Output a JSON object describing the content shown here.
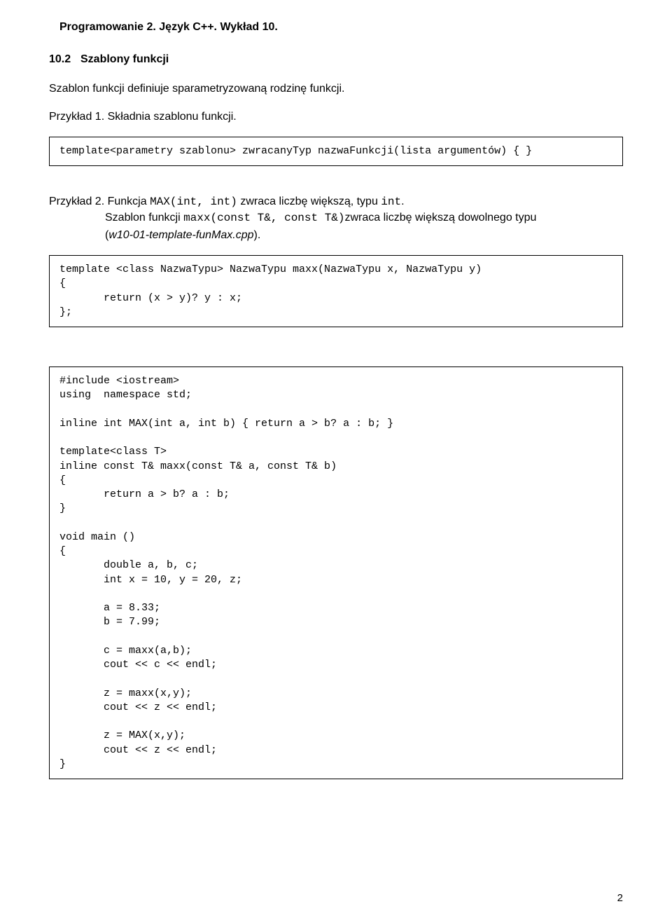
{
  "header": {
    "doc_title": "Programowanie 2. Język C++. Wykład 10."
  },
  "section": {
    "number": "10.2",
    "title": "Szablony funkcji"
  },
  "intro": {
    "sentence": "Szablon funkcji definiuje sparametryzowaną rodzinę funkcji.",
    "example1_label": "Przykład 1. Składnia szablonu funkcji."
  },
  "codebox1": {
    "line": "template<parametry szablonu> zwracanyTyp nazwaFunkcji(lista argumentów) { }"
  },
  "example2": {
    "line1_pre": "Przykład 2. Funkcja ",
    "line1_code": "MAX(int, int)",
    "line1_mid": " zwraca liczbę większą, typu ",
    "line1_code2": "int",
    "line1_end": ".",
    "indent_pre": "Szablon funkcji ",
    "indent_code": "maxx(const T&, const T&)",
    "indent_mid": "zwraca liczbę większą dowolnego typu",
    "indent_line2_pre": "(",
    "indent_line2_ital": "w10-01-template-funMax.cpp",
    "indent_line2_end": ")."
  },
  "codebox2": {
    "l1": "template <class NazwaTypu> NazwaTypu maxx(NazwaTypu x, NazwaTypu y)",
    "l2": "{",
    "l3": "       return (x > y)? y : x;",
    "l4": "};"
  },
  "codebox3": {
    "l1": "#include <iostream>",
    "l2": "using  namespace std;",
    "blank1": "",
    "l3": "inline int MAX(int a, int b) { return a > b? a : b; }",
    "blank2": "",
    "l4": "template<class T>",
    "l5": "inline const T& maxx(const T& a, const T& b)",
    "l6": "{",
    "l7": "       return a > b? a : b;",
    "l8": "}",
    "blank3": "",
    "l9": "void main ()",
    "l10": "{",
    "l11": "       double a, b, c;",
    "l12": "       int x = 10, y = 20, z;",
    "blank4": "",
    "l13": "       a = 8.33;",
    "l14": "       b = 7.99;",
    "blank5": "",
    "l15": "       c = maxx(a,b);",
    "l16": "       cout << c << endl;",
    "blank6": "",
    "l17": "       z = maxx(x,y);",
    "l18": "       cout << z << endl;",
    "blank7": "",
    "l19": "       z = MAX(x,y);",
    "l20": "       cout << z << endl;",
    "l21": "}"
  },
  "footer": {
    "page_number": "2"
  }
}
